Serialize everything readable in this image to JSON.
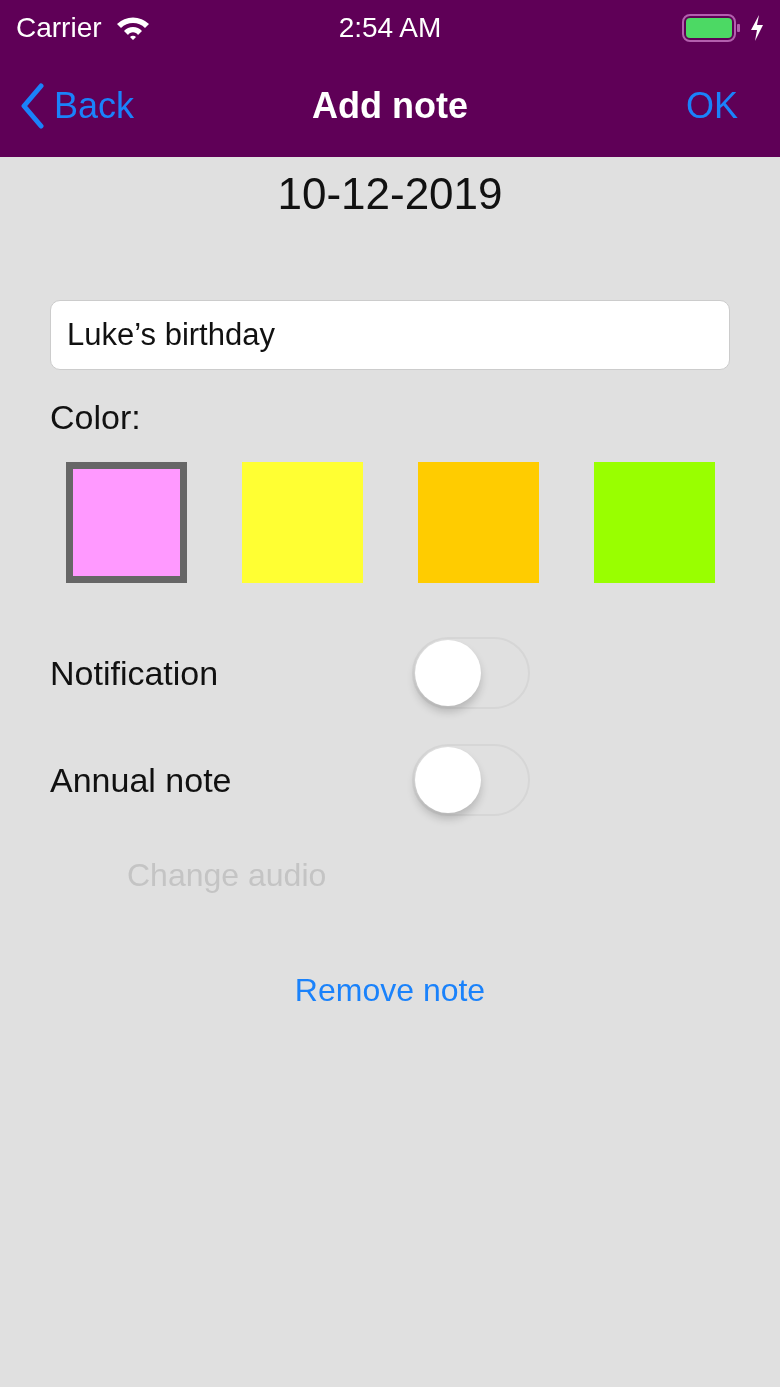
{
  "status_bar": {
    "carrier": "Carrier",
    "time": "2:54 AM"
  },
  "nav": {
    "back": "Back",
    "title": "Add note",
    "ok": "OK"
  },
  "date": "10-12-2019",
  "note_field": {
    "value": "Luke’s birthday"
  },
  "color_label": "Color:",
  "colors": [
    {
      "color": "#ff99ff",
      "selected": true
    },
    {
      "color": "#ffff33",
      "selected": false
    },
    {
      "color": "#ffcc00",
      "selected": false
    },
    {
      "color": "#99ff00",
      "selected": false
    }
  ],
  "switches": [
    {
      "label": "Notification",
      "on": false
    },
    {
      "label": "Annual note",
      "on": false
    }
  ],
  "change_audio": {
    "label": "Change audio",
    "disabled": true
  },
  "remove_button": "Remove note"
}
